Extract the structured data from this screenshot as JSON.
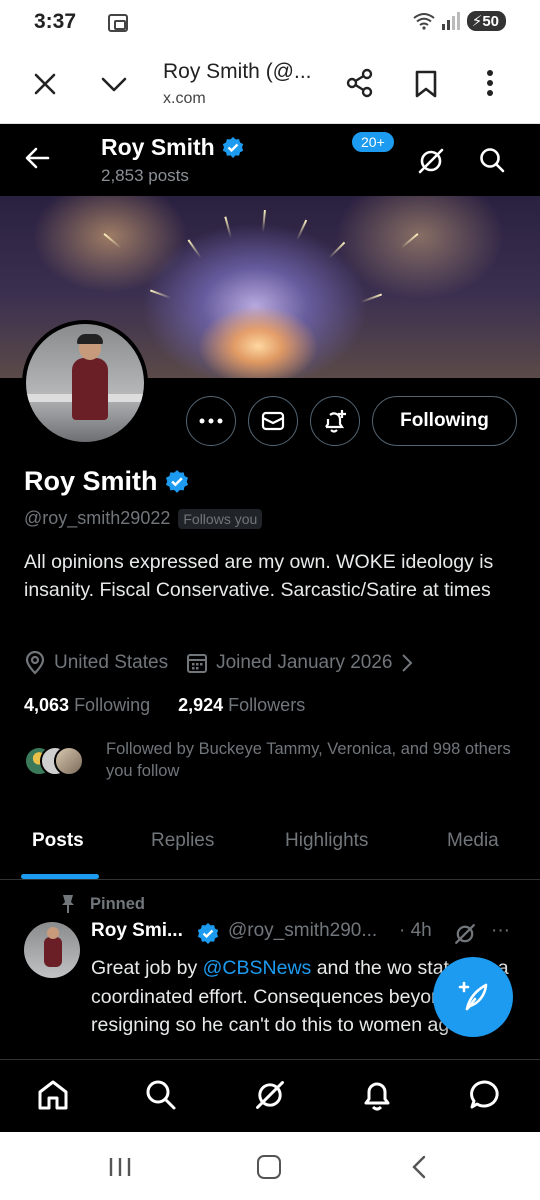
{
  "status_bar": {
    "time": "3:37",
    "battery": "50"
  },
  "browser": {
    "title": "Roy Smith (@...",
    "url": "x.com"
  },
  "header": {
    "name": "Roy Smith",
    "posts_count": "2,853 posts"
  },
  "profile": {
    "name": "Roy Smith",
    "handle": "@roy_smith29022",
    "follows_you": "Follows you",
    "bio": "All opinions expressed are my own. WOKE ideology is insanity.  Fiscal Conservative.  Sarcastic/Satire at times",
    "location": "United States",
    "joined": "Joined January 2026",
    "following_count": "4,063",
    "following_label": "Following",
    "followers_count": "2,924",
    "followers_label": "Followers",
    "followed_by": "Followed by Buckeye Tammy, Veronica, and 998 others you follow",
    "follow_button": "Following"
  },
  "tabs": [
    {
      "label": "Posts"
    },
    {
      "label": "Replies"
    },
    {
      "label": "Highlights"
    },
    {
      "label": "Media"
    }
  ],
  "post": {
    "pinned_label": "Pinned",
    "author": "Roy Smi...",
    "handle": "@roy_smith290...",
    "time": "· 4h",
    "more": "···",
    "text_before": "Great job by ",
    "mention": "@CBSNews",
    "text_after": " and the wo state not a coordinated effort. Consequences beyond resigning so he can't do this to women again."
  },
  "bottom_nav": {
    "notifications_badge": "20+"
  },
  "colors": {
    "accent": "#1d9bf0",
    "background": "#000000",
    "secondary_text": "#71767b"
  },
  "icons": [
    "close-icon",
    "chevron-down-icon",
    "share-icon",
    "bookmark-icon",
    "more-vert-icon",
    "back-arrow-icon",
    "grok-icon",
    "search-icon",
    "verified-badge-icon",
    "more-icon",
    "mail-icon",
    "bell-plus-icon",
    "location-icon",
    "calendar-icon",
    "chevron-right-icon",
    "pin-icon",
    "compose-icon",
    "home-icon",
    "notifications-icon",
    "messages-icon"
  ]
}
